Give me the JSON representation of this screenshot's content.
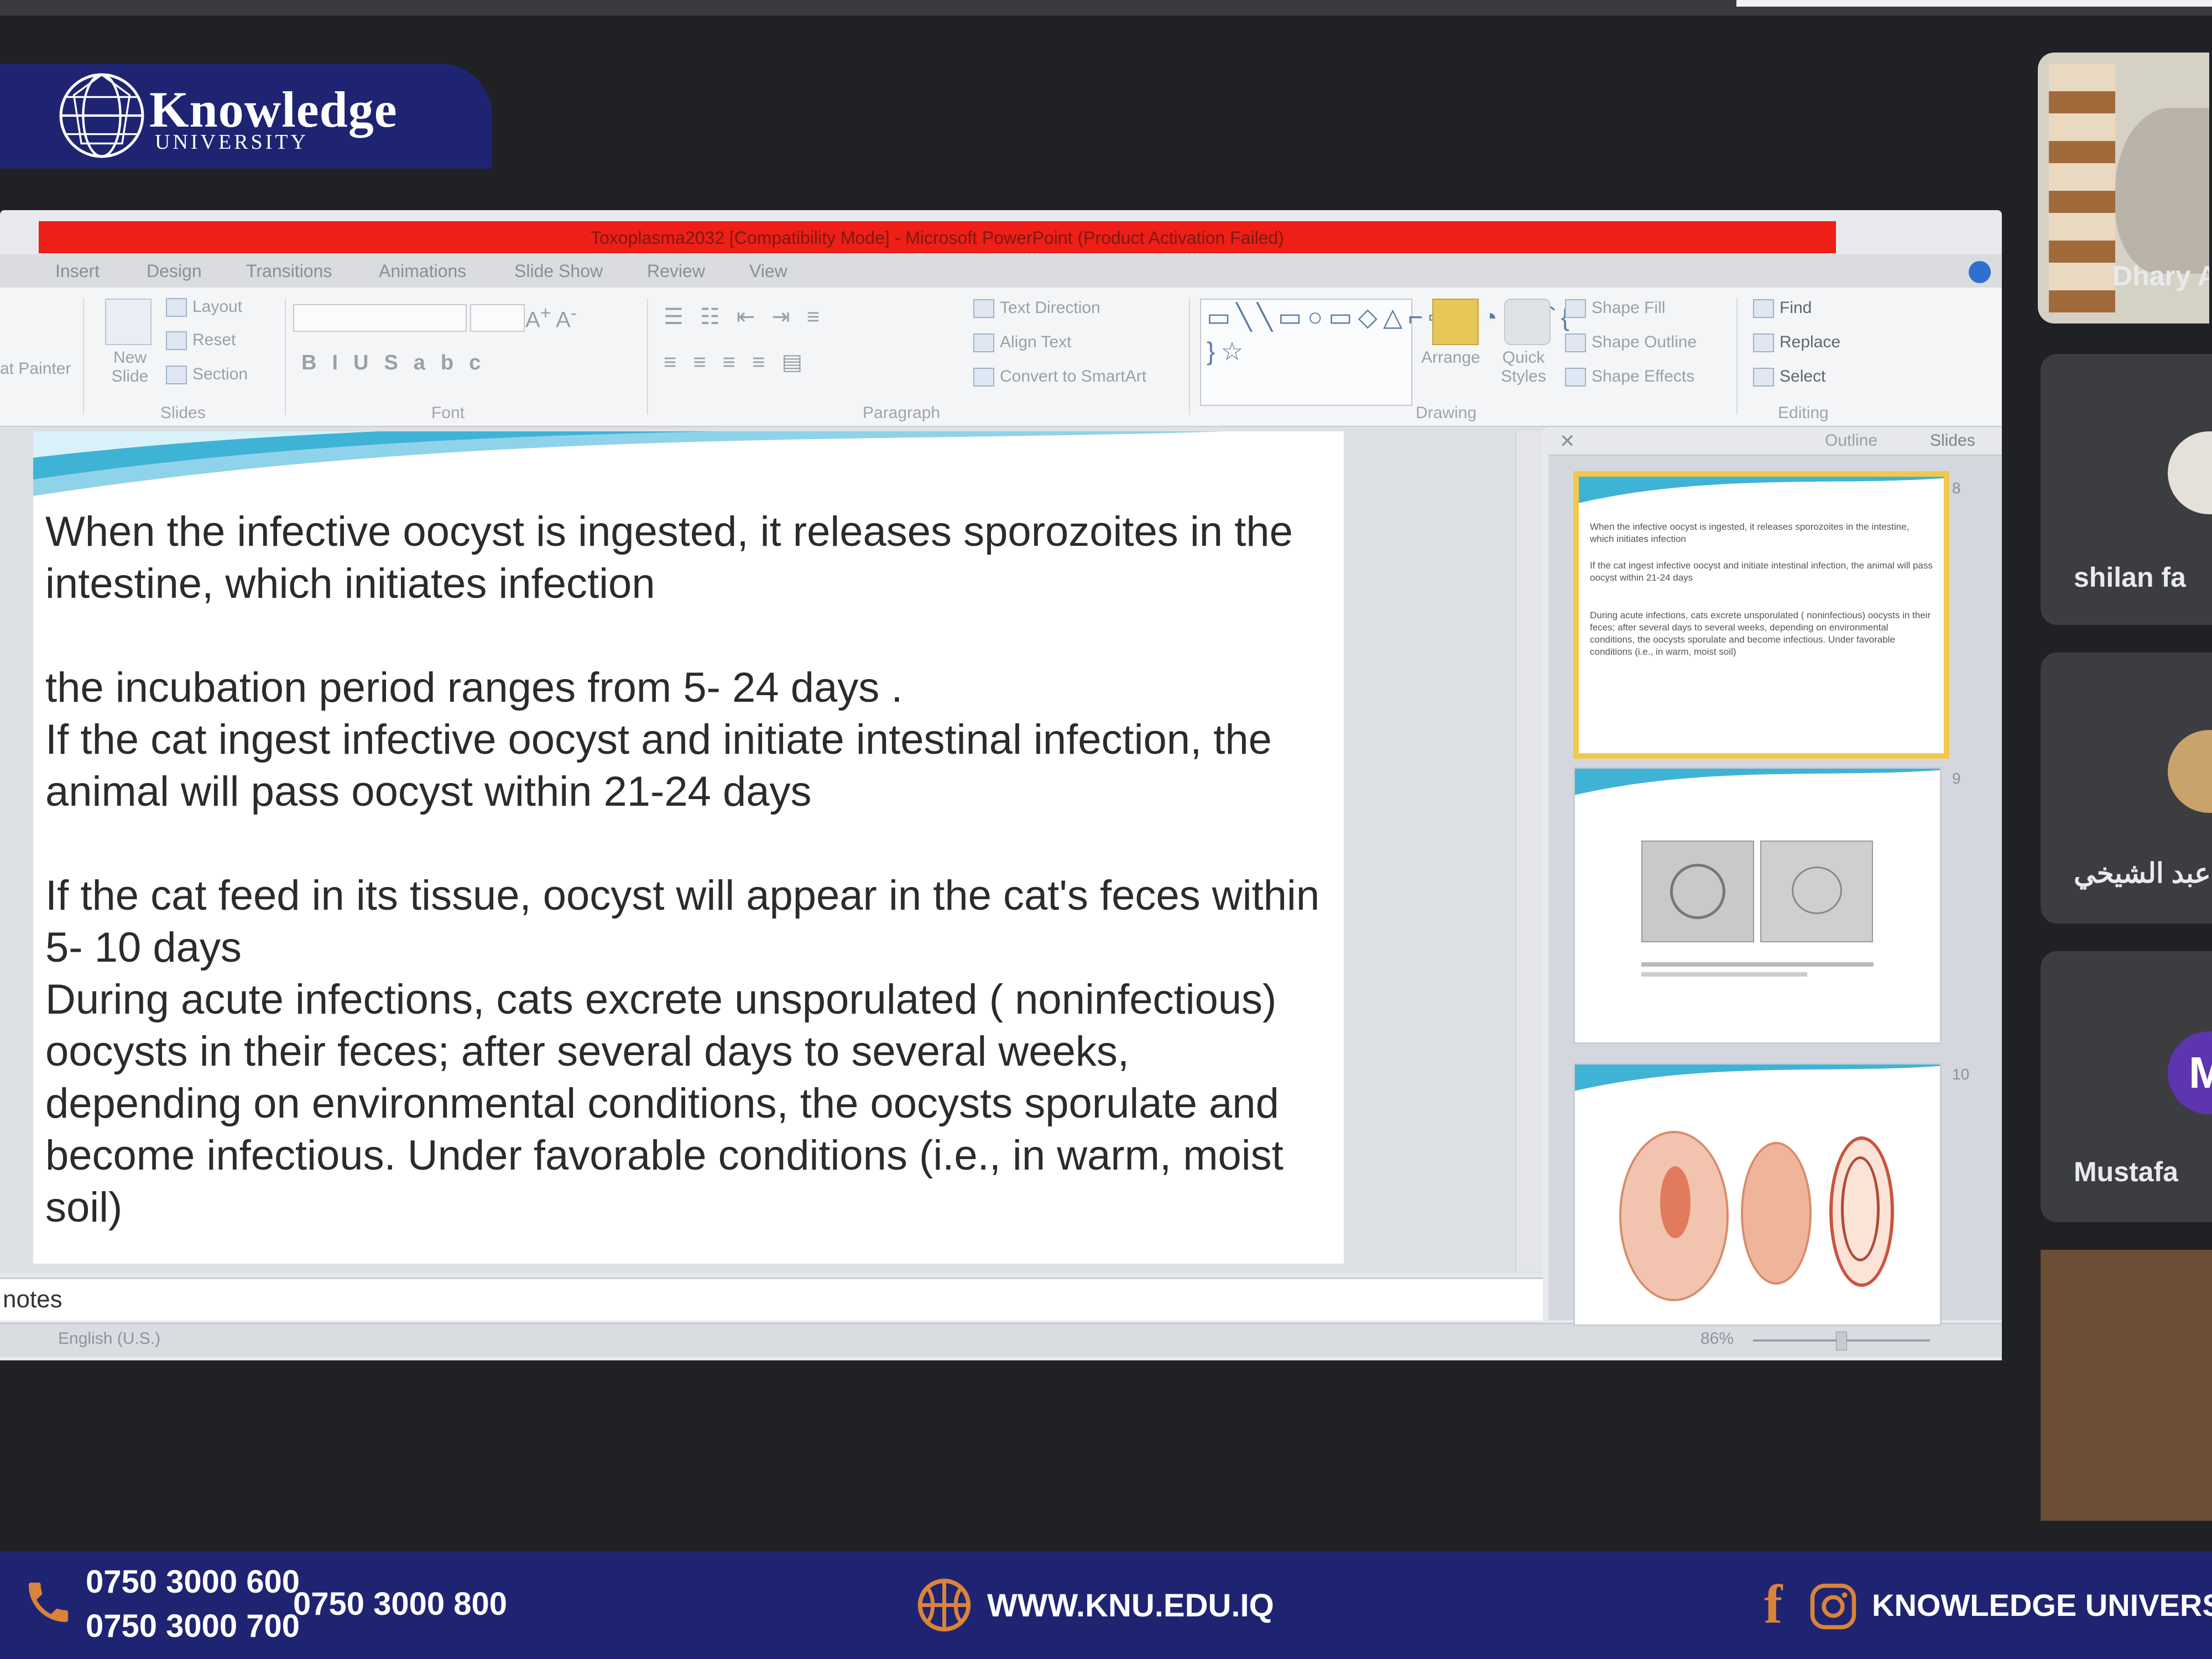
{
  "brand": {
    "name": "Knowledge",
    "subtitle": "UNIVERSITY"
  },
  "ppt": {
    "window_title": "Toxoplasma2032 [Compatibility Mode] - Microsoft PowerPoint (Product Activation Failed)",
    "tabs": [
      "Insert",
      "Design",
      "Transitions",
      "Animations",
      "Slide Show",
      "Review",
      "View"
    ],
    "ribbon": {
      "clipboard_label": "at Painter",
      "slides": {
        "new_slide": "New Slide",
        "layout": "Layout",
        "reset": "Reset",
        "section": "Section",
        "group": "Slides"
      },
      "font_group": "Font",
      "paragraph": {
        "text_direction": "Text Direction",
        "align_text": "Align Text",
        "smartart": "Convert to SmartArt",
        "group": "Paragraph"
      },
      "drawing": {
        "arrange": "Arrange",
        "quick_styles": "Quick Styles",
        "shape_fill": "Shape Fill",
        "shape_outline": "Shape Outline",
        "shape_effects": "Shape Effects",
        "group": "Drawing"
      },
      "editing": {
        "find": "Find",
        "replace": "Replace",
        "select": "Select",
        "group": "Editing"
      }
    },
    "slide_text": {
      "p1": "When the infective oocyst is ingested, it releases sporozoites in the intestine, which initiates infection",
      "p2": "the incubation period ranges from 5- 24 days .",
      "p3": "If the cat ingest infective oocyst and initiate intestinal infection, the animal will pass oocyst within 21-24 days",
      "p4": "If the cat feed  in its tissue, oocyst will appear in the cat's feces within 5- 10 days",
      "p5": "During acute infections, cats excrete unsporulated ( noninfectious) oocysts in their feces; after several days to several weeks, depending on environmental conditions, the oocysts sporulate and become infectious. Under favorable conditions (i.e., in warm, moist soil)"
    },
    "panel_tabs": {
      "outline": "Outline",
      "slides": "Slides"
    },
    "thumb_numbers": [
      "8",
      "9",
      "10"
    ],
    "notes_placeholder": "notes",
    "status": {
      "language": "English (U.S.)",
      "zoom": "86%"
    }
  },
  "participants": [
    {
      "name": "Dhary Al"
    },
    {
      "name": "shilan fa"
    },
    {
      "name": "عبد الشيخي"
    },
    {
      "name": "Mustafa",
      "initial": "M"
    }
  ],
  "footer": {
    "phone1": "0750 3000 600",
    "phone2": "0750 3000 700",
    "phone3": "0750 3000 800",
    "website": "WWW.KNU.EDU.IQ",
    "social": "KNOWLEDGE UNIVERSITY"
  },
  "colors": {
    "brand_navy": "#1f2472",
    "title_bar_red": "#ee1f16",
    "accent_orange": "#d9843a",
    "slide_wave": "#3fb3d6",
    "avatar_purple": "#5e35b1"
  },
  "icons": [
    "phone-icon",
    "basketball-icon",
    "facebook-icon",
    "instagram-icon",
    "globe-logo-icon"
  ]
}
